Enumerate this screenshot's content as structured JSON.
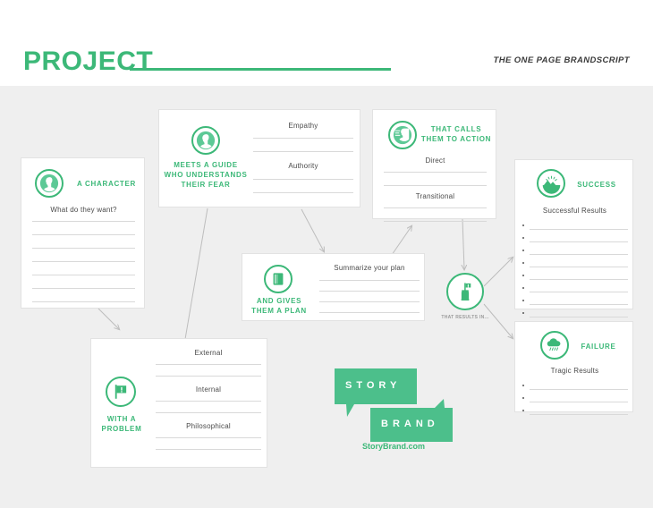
{
  "header": {
    "title": "PROJECT",
    "tagline": "THE ONE PAGE BRANDSCRIPT",
    "accent_color": "#3cb878",
    "background_color": "#efefef",
    "card_background": "#ffffff",
    "rule_present": true
  },
  "cards": [
    {
      "id": "character",
      "icon": "person-profile-icon",
      "label": "A CHARACTER",
      "fields": [
        {
          "label": "What do they want?",
          "lines": 8,
          "bulleted": false
        }
      ]
    },
    {
      "id": "guide",
      "icon": "person-profile-icon",
      "label": "MEETS A GUIDE WHO UNDERSTANDS THEIR FEAR",
      "label_lines": [
        "MEETS A GUIDE",
        "WHO UNDERSTANDS",
        "THEIR FEAR"
      ],
      "fields": [
        {
          "label": "Empathy",
          "lines": 2,
          "bulleted": false
        },
        {
          "label": "Authority",
          "lines": 2,
          "bulleted": false
        }
      ]
    },
    {
      "id": "callToAction",
      "icon": "megaphone-person-icon",
      "label": "THAT CALLS THEM TO ACTION",
      "label_lines": [
        "THAT CALLS",
        "THEM TO ACTION"
      ],
      "fields": [
        {
          "label": "Direct",
          "lines": 2,
          "bulleted": false
        },
        {
          "label": "Transitional",
          "lines": 2,
          "bulleted": false
        }
      ]
    },
    {
      "id": "success",
      "icon": "mountain-sunrise-icon",
      "label": "SUCCESS",
      "fields": [
        {
          "label": "Successful Results",
          "lines": 8,
          "bulleted": true
        }
      ]
    },
    {
      "id": "plan",
      "icon": "book-icon",
      "label": "AND GIVES THEM A PLAN",
      "label_lines": [
        "AND GIVES",
        "THEM A PLAN"
      ],
      "fields": [
        {
          "label": "Summarize your plan",
          "lines": 4,
          "bulleted": false
        }
      ]
    },
    {
      "id": "failure",
      "icon": "rain-cloud-icon",
      "label": "FAILURE",
      "fields": [
        {
          "label": "Tragic Results",
          "lines": 3,
          "bulleted": true
        }
      ]
    },
    {
      "id": "problem",
      "icon": "warning-flag-icon",
      "label": "WITH A PROBLEM",
      "label_lines": [
        "WITH A",
        "PROBLEM"
      ],
      "fields": [
        {
          "label": "External",
          "lines": 2,
          "bulleted": false
        },
        {
          "label": "Internal",
          "lines": 2,
          "bulleted": false
        },
        {
          "label": "Philosophical",
          "lines": 2,
          "bulleted": false
        }
      ]
    }
  ],
  "hub": {
    "icon": "castle-tower-icon",
    "label": "THAT RESULTS IN..."
  },
  "logo": {
    "line1": "STORY",
    "line2": "BRAND",
    "url": "StoryBrand.com"
  },
  "card_text": {
    "character_label": "A CHARACTER",
    "character_field": "What do they want?",
    "guide_l1": "MEETS A GUIDE",
    "guide_l2": "WHO UNDERSTANDS",
    "guide_l3": "THEIR FEAR",
    "guide_f1": "Empathy",
    "guide_f2": "Authority",
    "cta_l1": "THAT CALLS",
    "cta_l2": "THEM TO ACTION",
    "cta_f1": "Direct",
    "cta_f2": "Transitional",
    "success_label": "SUCCESS",
    "success_field": "Successful Results",
    "plan_l1": "AND GIVES",
    "plan_l2": "THEM A PLAN",
    "plan_field": "Summarize your plan",
    "failure_label": "FAILURE",
    "failure_field": "Tragic Results",
    "problem_l1": "WITH A",
    "problem_l2": "PROBLEM",
    "problem_f1": "External",
    "problem_f2": "Internal",
    "problem_f3": "Philosophical"
  }
}
